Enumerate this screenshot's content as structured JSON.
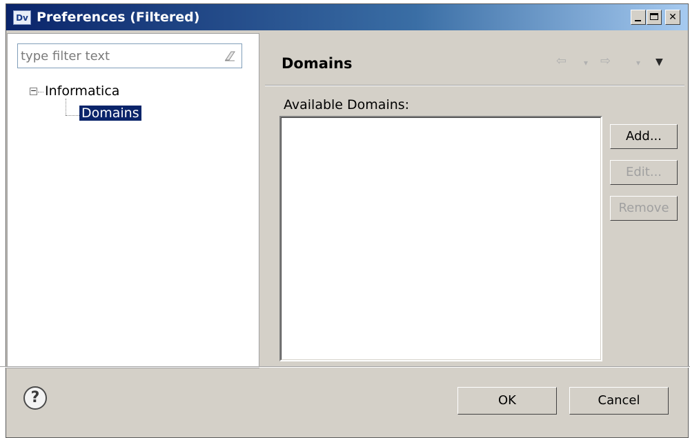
{
  "window": {
    "app_icon_text": "Dv",
    "title": "Preferences (Filtered)"
  },
  "filter": {
    "placeholder": "type filter text"
  },
  "tree": {
    "root": "Informatica",
    "child": "Domains"
  },
  "page": {
    "title": "Domains",
    "list_label": "Available Domains:"
  },
  "buttons": {
    "add": "Add...",
    "edit": "Edit...",
    "remove": "Remove",
    "ok": "OK",
    "cancel": "Cancel"
  },
  "colors": {
    "title_bar": "#0a246a",
    "selection": "#0a246a",
    "dialog_bg": "#d4d0c8"
  }
}
